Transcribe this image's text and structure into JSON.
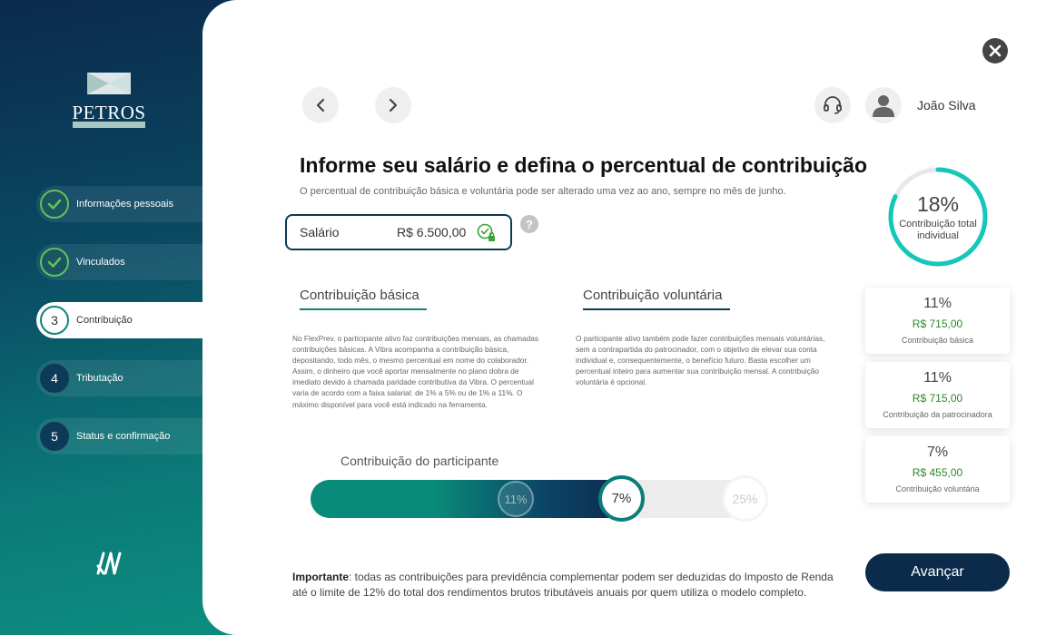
{
  "brand": {
    "name": "PETROS"
  },
  "steps": [
    {
      "number": "",
      "label": "Informações pessoais",
      "state": "done"
    },
    {
      "number": "",
      "label": "Vinculados",
      "state": "done"
    },
    {
      "number": "3",
      "label": "Contribuição",
      "state": "active"
    },
    {
      "number": "4",
      "label": "Tributação",
      "state": "pending"
    },
    {
      "number": "5",
      "label": "Status e confirmação",
      "state": "pending"
    }
  ],
  "header": {
    "user_name": "João Silva"
  },
  "page": {
    "title": "Informe seu salário e defina o percentual de contribuição",
    "subtitle": "O percentual de contribuição básica e voluntária pode ser alterado uma vez ao ano, sempre no mês de junho."
  },
  "salary": {
    "label": "Salário",
    "value": "R$ 6.500,00",
    "help": "?"
  },
  "tabs": {
    "basic": "Contribuição básica",
    "voluntary": "Contribuição voluntária"
  },
  "descriptions": {
    "basic": "No FlexPrev, o participante ativo faz contribuições mensais, as chamadas contribuições básicas. A Vibra acompanha a contribuição básica, depositando, todo mês, o mesmo percentual em nome do colaborador. Assim, o dinheiro que você aportar mensalmente no plano dobra de imediato devido à chamada paridade contributiva da Vibra. O percentual varia de acordo com a faixa salarial: de 1% a 5% ou de 1% a 11%. O máximo disponível para você está indicado na ferramenta.",
    "voluntary": "O participante ativo também pode fazer contribuições mensais voluntárias, sem a contrapartida do patrocinador, com o objetivo de elevar sua conta individual e, consequentemente, o benefício futuro. Basta escolher um percentual inteiro para aumentar sua contribuição mensal. A contribuição voluntária é opcional."
  },
  "slider": {
    "label": "Contribuição do participante",
    "basic_marker": "11%",
    "current": "7%",
    "max": "25%",
    "fill_fraction": 0.68
  },
  "important": {
    "label": "Importante",
    "text": ": todas as contribuições para previdência complementar podem ser deduzidas do Imposto de Renda até o limite de 12% do total dos rendimentos brutos tributáveis anuais por quem utiliza o modelo completo."
  },
  "advance_button": "Avançar",
  "summary": {
    "total_pct": "18%",
    "total_label": "Contribuição total individual",
    "ring_fraction": 0.82,
    "cards": [
      {
        "pct": "11%",
        "amount": "R$ 715,00",
        "label": "Contribuição básica"
      },
      {
        "pct": "11%",
        "amount": "R$ 715,00",
        "label": "Contribuição da patrocinadora"
      },
      {
        "pct": "7%",
        "amount": "R$ 455,00",
        "label": "Contribuição voluntária"
      }
    ]
  },
  "colors": {
    "accent_teal": "#0b8576",
    "navy": "#0c2b4a",
    "success_green": "#5fc35b",
    "amount_green": "#2c8a28",
    "ring_cyan": "#15c7b8"
  }
}
